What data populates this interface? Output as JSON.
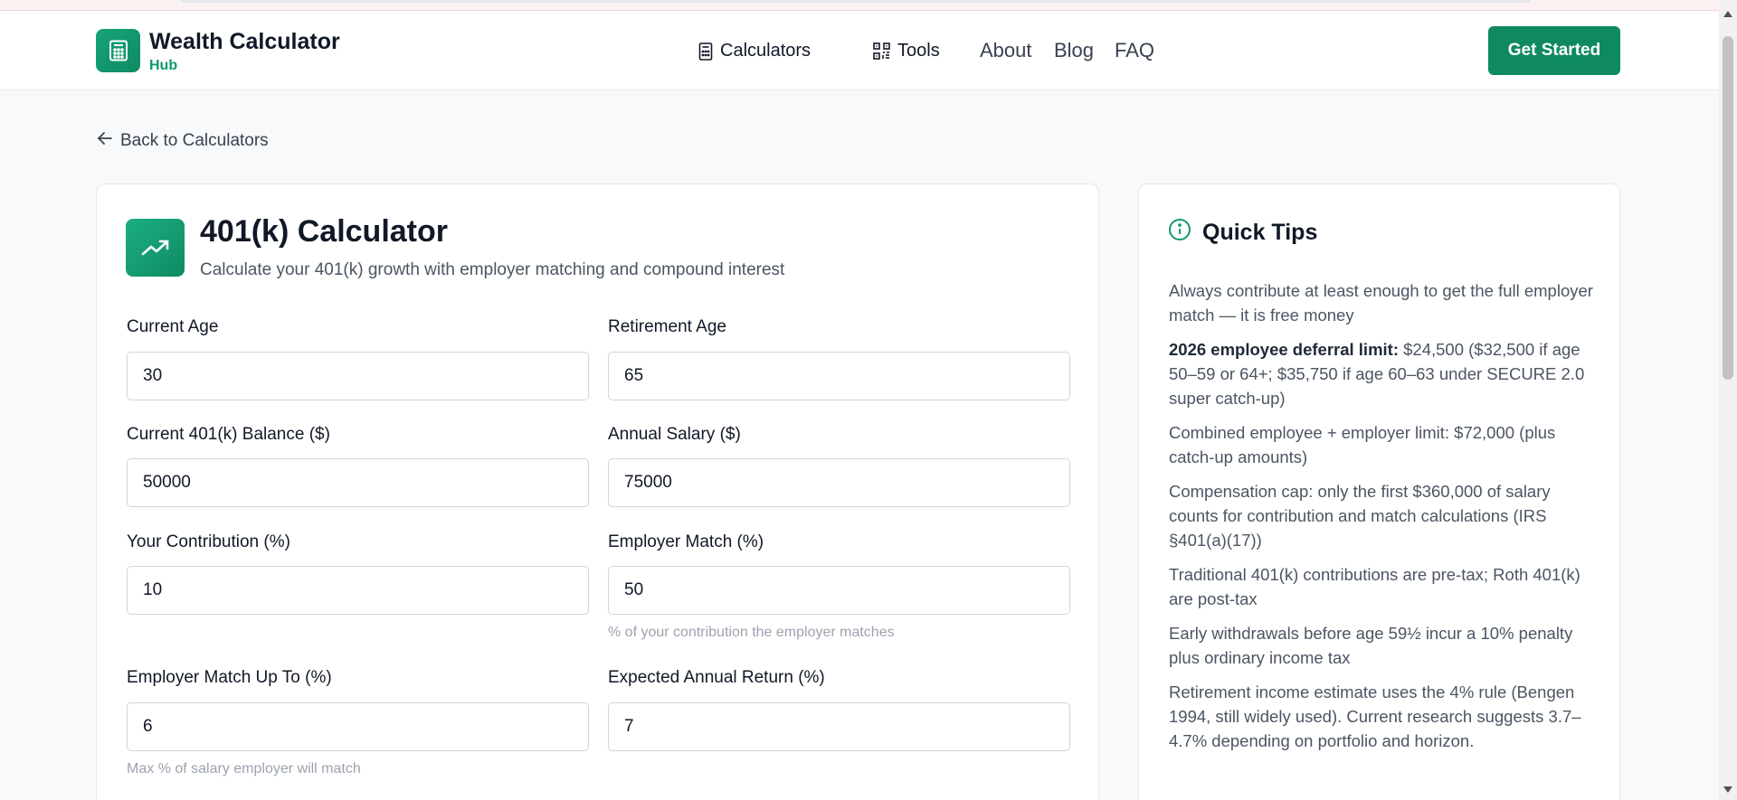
{
  "header": {
    "logo_icon": "calculator-icon",
    "title": "Wealth Calculator",
    "subtitle": "Hub",
    "nav": [
      {
        "label": "Calculators",
        "icon": "calculator-icon"
      },
      {
        "label": "Tools",
        "icon": "qr-grid-icon"
      },
      {
        "label": "About"
      },
      {
        "label": "Blog"
      },
      {
        "label": "FAQ"
      }
    ],
    "cta": "Get Started"
  },
  "back_link": {
    "label": "Back to Calculators",
    "icon": "arrow-left-icon"
  },
  "calculator": {
    "icon": "trending-up-icon",
    "title": "401(k) Calculator",
    "subtitle": "Calculate your 401(k) growth with employer matching and compound interest",
    "fields": {
      "current_age": {
        "label": "Current Age",
        "value": "30"
      },
      "retirement_age": {
        "label": "Retirement Age",
        "value": "65"
      },
      "balance": {
        "label": "Current 401(k) Balance ($)",
        "value": "50000"
      },
      "salary": {
        "label": "Annual Salary ($)",
        "value": "75000"
      },
      "contribution": {
        "label": "Your Contribution (%)",
        "value": "10"
      },
      "employer_match": {
        "label": "Employer Match (%)",
        "value": "50",
        "hint": "% of your contribution the employer matches"
      },
      "match_up_to": {
        "label": "Employer Match Up To (%)",
        "value": "6",
        "hint": "Max % of salary employer will match"
      },
      "annual_return": {
        "label": "Expected Annual Return (%)",
        "value": "7"
      }
    }
  },
  "tips": {
    "icon": "info-icon",
    "title": "Quick Tips",
    "items": [
      {
        "text": "Always contribute at least enough to get the full employer match — it is free money"
      },
      {
        "bold": "2026 employee deferral limit:",
        "text": " $24,500 ($32,500 if age 50–59 or 64+; $35,750 if age 60–63 under SECURE 2.0 super catch-up)"
      },
      {
        "text": "Combined employee + employer limit: $72,000 (plus catch-up amounts)"
      },
      {
        "text": "Compensation cap: only the first $360,000 of salary counts for contribution and match calculations (IRS §401(a)(17))"
      },
      {
        "text": "Traditional 401(k) contributions are pre-tax; Roth 401(k) are post-tax"
      },
      {
        "text": "Early withdrawals before age 59½ incur a 10% penalty plus ordinary income tax"
      },
      {
        "text": "Retirement income estimate uses the 4% rule (Bengen 1994, still widely used). Current research suggests 3.7–4.7% depending on portfolio and horizon."
      }
    ]
  },
  "colors": {
    "brand": "#0f8a5f",
    "brand_text": "#0f9a6a"
  }
}
